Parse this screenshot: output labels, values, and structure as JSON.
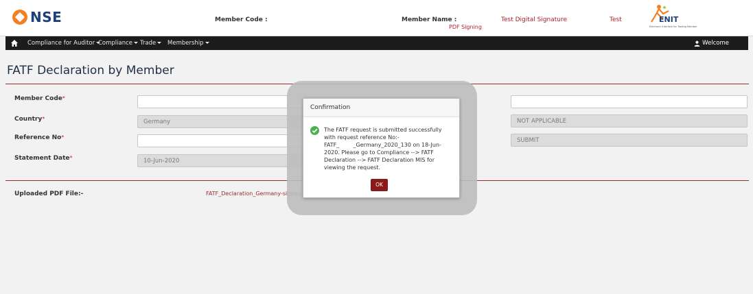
{
  "header": {
    "logo_text": "NSE",
    "member_code_label": "Member Code :",
    "member_name_label": "Member Name :",
    "pdf_signing": "PDF Signing",
    "test_digital_signature": "Test Digital Signature",
    "test": "Test",
    "enit_logo": "ENIT",
    "enit_tagline": "Electronic Interface for Trading Member"
  },
  "nav": {
    "items": [
      {
        "label": "Compliance for Auditor"
      },
      {
        "label": "Compliance"
      },
      {
        "label": "Trade"
      },
      {
        "label": "Membership"
      }
    ],
    "welcome": "Welcome"
  },
  "page": {
    "title": "FATF Declaration by Member"
  },
  "form": {
    "member_code_label": "Member Code",
    "country_label": "Country",
    "reference_no_label": "Reference No",
    "statement_date_label": "Statement Date",
    "required_mark": "*",
    "country_value": "Germany",
    "statement_date_value": "10-Jun-2020",
    "right_field2_value": "NOT APPLICABLE",
    "right_field3_value": "SUBMIT",
    "uploaded_label": "Uploaded PDF File:-",
    "uploaded_file": "FATF_Declaration_Germany-signed.pdf"
  },
  "modal": {
    "title": "Confirmation",
    "message_lines": [
      "The FATF request is submitted successfully",
      "with request reference No:-",
      "FATF_        _Germany_2020_130 on 18-Jun-",
      "2020. Please go to Compliance --> FATF",
      "Declaration --> FATF Declaration MIS for",
      "viewing the request."
    ],
    "ok_label": "OK"
  },
  "colors": {
    "brand_orange": "#f47f20",
    "brand_navy": "#1d3f7a",
    "accent_red": "#8b1a1a",
    "nav_bg": "#1c1c1c",
    "success_green": "#4caf50"
  }
}
